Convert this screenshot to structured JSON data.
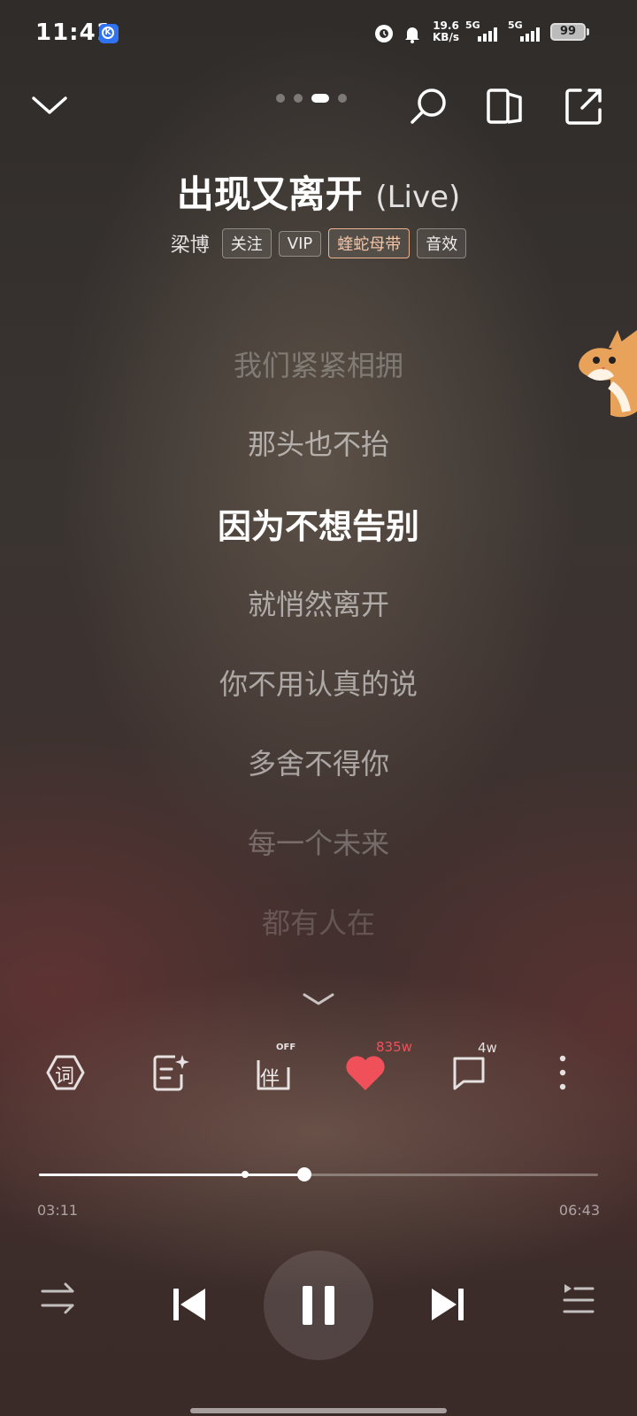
{
  "status_bar": {
    "time": "11:41",
    "app_badge": "K",
    "net_speed_value": "19.6",
    "net_speed_unit": "KB/s",
    "sim1_type": "5G",
    "sim2_type": "5G",
    "battery": "99"
  },
  "header": {
    "page_dots": 4,
    "active_dot": 2
  },
  "song": {
    "title": "出现又离开",
    "title_suffix": "(Live)",
    "artist": "梁博",
    "tags": [
      "关注",
      "VIP",
      "蝰蛇母带",
      "音效"
    ]
  },
  "lyrics": [
    "我们紧紧相拥",
    "那头也不抬",
    "因为不想告别",
    "就悄然离开",
    "你不用认真的说",
    "多舍不得你",
    "每一个未来",
    "都有人在"
  ],
  "current_lyric_index": 2,
  "actions": {
    "lyrics_icon_text": "词",
    "accompany_icon_text": "伴",
    "accompany_state": "OFF",
    "like_count": "835w",
    "comment_count": "4w"
  },
  "progress": {
    "elapsed": "03:11",
    "total": "06:43",
    "played_fraction": 0.474,
    "marker_fraction": 0.368
  },
  "colors": {
    "like": "#f0505a",
    "tag_highlight": "#f7c6a6"
  },
  "icons": [
    "collapse-icon",
    "search-icon",
    "device-switch-icon",
    "share-icon",
    "lyrics-icon",
    "ai-notes-icon",
    "accompany-icon",
    "heart-icon",
    "comment-icon",
    "more-icon",
    "shuffle-icon",
    "previous-icon",
    "pause-icon",
    "next-icon",
    "playlist-icon"
  ]
}
